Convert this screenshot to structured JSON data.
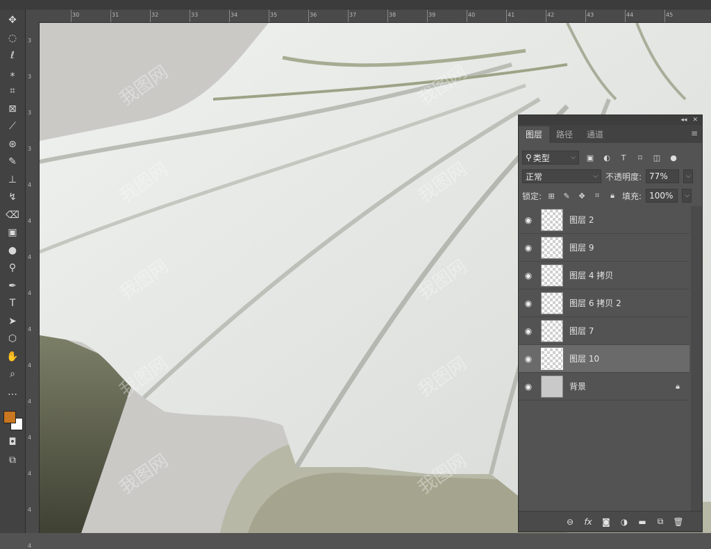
{
  "ruler": {
    "top_ticks": [
      "30",
      "31",
      "32",
      "33",
      "34",
      "35",
      "36",
      "37",
      "38",
      "39",
      "40",
      "41",
      "42",
      "43",
      "44",
      "45"
    ],
    "left_ticks": [
      "3",
      "3",
      "3",
      "3",
      "4",
      "4",
      "4",
      "4",
      "4",
      "4",
      "4",
      "4",
      "4",
      "4",
      "4"
    ]
  },
  "toolbar": {
    "tools": [
      {
        "name": "move-tool",
        "glyph": "✥"
      },
      {
        "name": "marquee-tool",
        "glyph": "◌"
      },
      {
        "name": "lasso-tool",
        "glyph": "ℓ"
      },
      {
        "name": "magic-wand-tool",
        "glyph": "⁎"
      },
      {
        "name": "crop-tool",
        "glyph": "⌗"
      },
      {
        "name": "frame-tool",
        "glyph": "⊠"
      },
      {
        "name": "eyedropper-tool",
        "glyph": "⟋"
      },
      {
        "name": "patch-tool",
        "glyph": "⊛"
      },
      {
        "name": "brush-tool",
        "glyph": "✎"
      },
      {
        "name": "stamp-tool",
        "glyph": "⊥"
      },
      {
        "name": "history-brush-tool",
        "glyph": "↯"
      },
      {
        "name": "eraser-tool",
        "glyph": "⌫"
      },
      {
        "name": "gradient-tool",
        "glyph": "▣"
      },
      {
        "name": "blur-tool",
        "glyph": "●"
      },
      {
        "name": "dodge-tool",
        "glyph": "⚲"
      },
      {
        "name": "pen-tool",
        "glyph": "✒"
      },
      {
        "name": "type-tool",
        "glyph": "T"
      },
      {
        "name": "path-selection-tool",
        "glyph": "➤"
      },
      {
        "name": "shape-tool",
        "glyph": "⬡"
      },
      {
        "name": "hand-tool",
        "glyph": "✋"
      },
      {
        "name": "zoom-tool",
        "glyph": "⌕"
      },
      {
        "name": "more-tools",
        "glyph": "…"
      }
    ],
    "foreground_color": "#c8761f",
    "background_color": "#ffffff"
  },
  "panel": {
    "tabs": [
      "图层",
      "路径",
      "通道"
    ],
    "filter": {
      "label": "类型"
    },
    "blend_mode": "正常",
    "opacity": {
      "label": "不透明度:",
      "value": "77%"
    },
    "lock": {
      "label": "锁定:"
    },
    "fill": {
      "label": "填充:",
      "value": "100%"
    },
    "layers": [
      {
        "name": "图层 2",
        "selected": false,
        "locked": false,
        "type": "transparent"
      },
      {
        "name": "图层 9",
        "selected": false,
        "locked": false,
        "type": "transparent"
      },
      {
        "name": "图层 4 拷贝",
        "selected": false,
        "locked": false,
        "type": "transparent"
      },
      {
        "name": "图层 6 拷贝 2",
        "selected": false,
        "locked": false,
        "type": "transparent"
      },
      {
        "name": "图层 7",
        "selected": false,
        "locked": false,
        "type": "transparent"
      },
      {
        "name": "图层 10",
        "selected": true,
        "locked": false,
        "type": "transparent"
      },
      {
        "name": "背景",
        "selected": false,
        "locked": true,
        "type": "background"
      }
    ]
  },
  "watermark": "我图网",
  "colors": {
    "panel_bg": "#535353",
    "selected_row": "#6a6a6a",
    "canvas_bg": "#cac9c6",
    "umbrella": "#e3e6e4"
  }
}
